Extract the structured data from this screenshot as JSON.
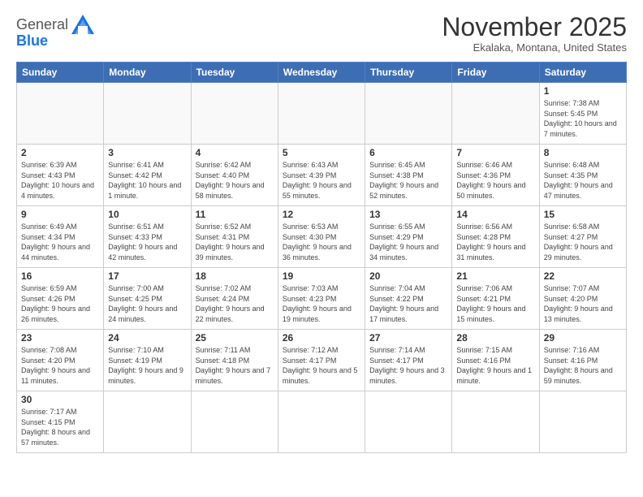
{
  "logo": {
    "text_general": "General",
    "text_blue": "Blue"
  },
  "title": "November 2025",
  "subtitle": "Ekalaka, Montana, United States",
  "weekdays": [
    "Sunday",
    "Monday",
    "Tuesday",
    "Wednesday",
    "Thursday",
    "Friday",
    "Saturday"
  ],
  "weeks": [
    [
      {
        "day": "",
        "info": ""
      },
      {
        "day": "",
        "info": ""
      },
      {
        "day": "",
        "info": ""
      },
      {
        "day": "",
        "info": ""
      },
      {
        "day": "",
        "info": ""
      },
      {
        "day": "",
        "info": ""
      },
      {
        "day": "1",
        "info": "Sunrise: 7:38 AM\nSunset: 5:45 PM\nDaylight: 10 hours\nand 7 minutes."
      }
    ],
    [
      {
        "day": "2",
        "info": "Sunrise: 6:39 AM\nSunset: 4:43 PM\nDaylight: 10 hours\nand 4 minutes."
      },
      {
        "day": "3",
        "info": "Sunrise: 6:41 AM\nSunset: 4:42 PM\nDaylight: 10 hours\nand 1 minute."
      },
      {
        "day": "4",
        "info": "Sunrise: 6:42 AM\nSunset: 4:40 PM\nDaylight: 9 hours\nand 58 minutes."
      },
      {
        "day": "5",
        "info": "Sunrise: 6:43 AM\nSunset: 4:39 PM\nDaylight: 9 hours\nand 55 minutes."
      },
      {
        "day": "6",
        "info": "Sunrise: 6:45 AM\nSunset: 4:38 PM\nDaylight: 9 hours\nand 52 minutes."
      },
      {
        "day": "7",
        "info": "Sunrise: 6:46 AM\nSunset: 4:36 PM\nDaylight: 9 hours\nand 50 minutes."
      },
      {
        "day": "8",
        "info": "Sunrise: 6:48 AM\nSunset: 4:35 PM\nDaylight: 9 hours\nand 47 minutes."
      }
    ],
    [
      {
        "day": "9",
        "info": "Sunrise: 6:49 AM\nSunset: 4:34 PM\nDaylight: 9 hours\nand 44 minutes."
      },
      {
        "day": "10",
        "info": "Sunrise: 6:51 AM\nSunset: 4:33 PM\nDaylight: 9 hours\nand 42 minutes."
      },
      {
        "day": "11",
        "info": "Sunrise: 6:52 AM\nSunset: 4:31 PM\nDaylight: 9 hours\nand 39 minutes."
      },
      {
        "day": "12",
        "info": "Sunrise: 6:53 AM\nSunset: 4:30 PM\nDaylight: 9 hours\nand 36 minutes."
      },
      {
        "day": "13",
        "info": "Sunrise: 6:55 AM\nSunset: 4:29 PM\nDaylight: 9 hours\nand 34 minutes."
      },
      {
        "day": "14",
        "info": "Sunrise: 6:56 AM\nSunset: 4:28 PM\nDaylight: 9 hours\nand 31 minutes."
      },
      {
        "day": "15",
        "info": "Sunrise: 6:58 AM\nSunset: 4:27 PM\nDaylight: 9 hours\nand 29 minutes."
      }
    ],
    [
      {
        "day": "16",
        "info": "Sunrise: 6:59 AM\nSunset: 4:26 PM\nDaylight: 9 hours\nand 26 minutes."
      },
      {
        "day": "17",
        "info": "Sunrise: 7:00 AM\nSunset: 4:25 PM\nDaylight: 9 hours\nand 24 minutes."
      },
      {
        "day": "18",
        "info": "Sunrise: 7:02 AM\nSunset: 4:24 PM\nDaylight: 9 hours\nand 22 minutes."
      },
      {
        "day": "19",
        "info": "Sunrise: 7:03 AM\nSunset: 4:23 PM\nDaylight: 9 hours\nand 19 minutes."
      },
      {
        "day": "20",
        "info": "Sunrise: 7:04 AM\nSunset: 4:22 PM\nDaylight: 9 hours\nand 17 minutes."
      },
      {
        "day": "21",
        "info": "Sunrise: 7:06 AM\nSunset: 4:21 PM\nDaylight: 9 hours\nand 15 minutes."
      },
      {
        "day": "22",
        "info": "Sunrise: 7:07 AM\nSunset: 4:20 PM\nDaylight: 9 hours\nand 13 minutes."
      }
    ],
    [
      {
        "day": "23",
        "info": "Sunrise: 7:08 AM\nSunset: 4:20 PM\nDaylight: 9 hours\nand 11 minutes."
      },
      {
        "day": "24",
        "info": "Sunrise: 7:10 AM\nSunset: 4:19 PM\nDaylight: 9 hours\nand 9 minutes."
      },
      {
        "day": "25",
        "info": "Sunrise: 7:11 AM\nSunset: 4:18 PM\nDaylight: 9 hours\nand 7 minutes."
      },
      {
        "day": "26",
        "info": "Sunrise: 7:12 AM\nSunset: 4:17 PM\nDaylight: 9 hours\nand 5 minutes."
      },
      {
        "day": "27",
        "info": "Sunrise: 7:14 AM\nSunset: 4:17 PM\nDaylight: 9 hours\nand 3 minutes."
      },
      {
        "day": "28",
        "info": "Sunrise: 7:15 AM\nSunset: 4:16 PM\nDaylight: 9 hours\nand 1 minute."
      },
      {
        "day": "29",
        "info": "Sunrise: 7:16 AM\nSunset: 4:16 PM\nDaylight: 8 hours\nand 59 minutes."
      }
    ],
    [
      {
        "day": "30",
        "info": "Sunrise: 7:17 AM\nSunset: 4:15 PM\nDaylight: 8 hours\nand 57 minutes."
      },
      {
        "day": "",
        "info": ""
      },
      {
        "day": "",
        "info": ""
      },
      {
        "day": "",
        "info": ""
      },
      {
        "day": "",
        "info": ""
      },
      {
        "day": "",
        "info": ""
      },
      {
        "day": "",
        "info": ""
      }
    ]
  ]
}
